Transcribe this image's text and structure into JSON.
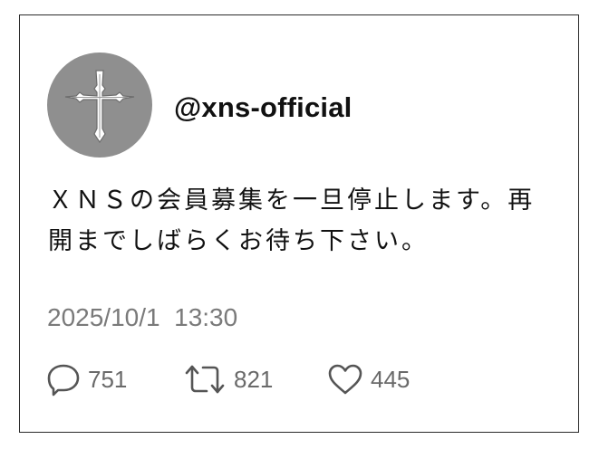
{
  "tweet": {
    "handle": "@xns-official",
    "text": "ＸＮＳの会員募集を一旦停止します。再開までしばらくお待ち下さい。",
    "timestamp": "2025/10/1  13:30",
    "avatar": {
      "icon": "cross-icon",
      "background_color": "#8f8f8f"
    },
    "actions": {
      "replies": "751",
      "retweets": "821",
      "likes": "445"
    }
  }
}
